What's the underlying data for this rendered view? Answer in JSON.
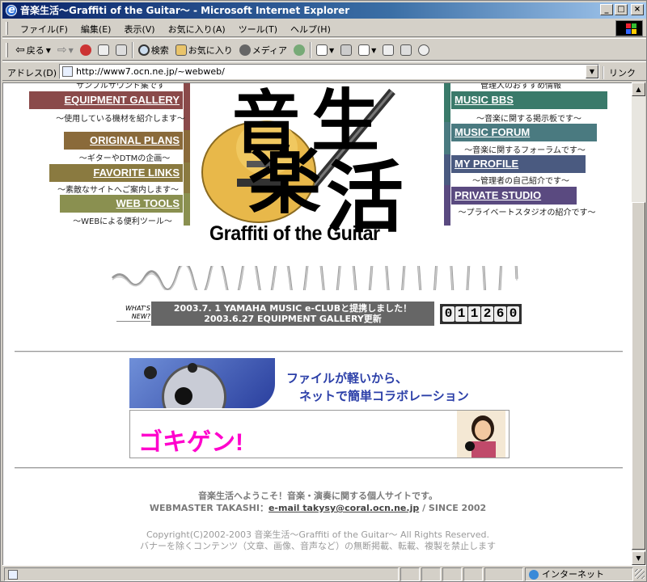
{
  "window": {
    "title": "音楽生活～Graffiti of the Guitar～ - Microsoft Internet Explorer",
    "controls": {
      "minimize": "_",
      "maximize": "□",
      "close": "×"
    }
  },
  "menubar": {
    "items": [
      "ファイル(F)",
      "編集(E)",
      "表示(V)",
      "お気に入り(A)",
      "ツール(T)",
      "ヘルプ(H)"
    ]
  },
  "toolbar": {
    "back": "戻る",
    "search": "検索",
    "favorites": "お気に入り",
    "media": "メディア"
  },
  "addressbar": {
    "label": "アドレス(D)",
    "url": "http://www7.ocn.ne.jp/~webweb/",
    "links": "リンク"
  },
  "nav_left": [
    {
      "label": "EQUIPMENT GALLERY",
      "desc": "～使用している機材を紹介します～",
      "color": "#8a4a4a"
    },
    {
      "label": "ORIGINAL PLANS",
      "desc": "～ギターやDTMの企画～",
      "color": "#8a6a3a"
    },
    {
      "label": "FAVORITE LINKS",
      "desc": "～素敵なサイトへご案内します～",
      "color": "#8a7a40"
    },
    {
      "label": "WEB TOOLS",
      "desc": "～WEBによる便利ツール～",
      "color": "#8a9050"
    }
  ],
  "nav_left_top_partial": "サンプルサウンド集です",
  "nav_right": [
    {
      "label": "MUSIC BBS",
      "desc": "～音楽に関する掲示板です～",
      "color": "#3a7a6a"
    },
    {
      "label": "MUSIC FORUM",
      "desc": "～音楽に関するフォーラムです～",
      "color": "#4a7a80"
    },
    {
      "label": "MY PROFILE",
      "desc": "～管理者の自己紹介です～",
      "color": "#4a5a80"
    },
    {
      "label": "PRIVATE STUDIO",
      "desc": "～プライベートスタジオの紹介です～",
      "color": "#5a4a80"
    }
  ],
  "nav_right_top_partial": "管理人のおすすめ情報",
  "logo": {
    "kanji": [
      "音",
      "生",
      "楽",
      "活"
    ],
    "subtitle": "Graffiti of the Guitar"
  },
  "news": {
    "label": "WHAT'S NEW?",
    "lines": [
      "2003.7. 1 YAMAHA MUSIC e-CLUBと提携しました！",
      "2003.6.27 EQUIPMENT GALLERY更新"
    ]
  },
  "counter": [
    "0",
    "1",
    "1",
    "2",
    "6",
    "0"
  ],
  "banner1": {
    "line1": "ファイルが軽いから、",
    "line2": "ネットで簡単コラボレーション"
  },
  "banner2": {
    "text": "ゴキゲン!"
  },
  "footer": {
    "welcome": "音楽生活へようこそ！音楽・演奏に関する個人サイトです。",
    "webmaster_prefix": "WEBMASTER TAKASHI：",
    "email": "e-mail takysy@coral.ocn.ne.jp",
    "since": "/ SINCE 2002",
    "copyright": "Copyright(C)2002-2003 音楽生活～Graffiti of the Guitar～ All Rights Reserved.",
    "notice": "バナーを除くコンテンツ（文章、画像、音声など）の無断掲載、転載、複製を禁止します"
  },
  "statusbar": {
    "zone": "インターネット"
  }
}
